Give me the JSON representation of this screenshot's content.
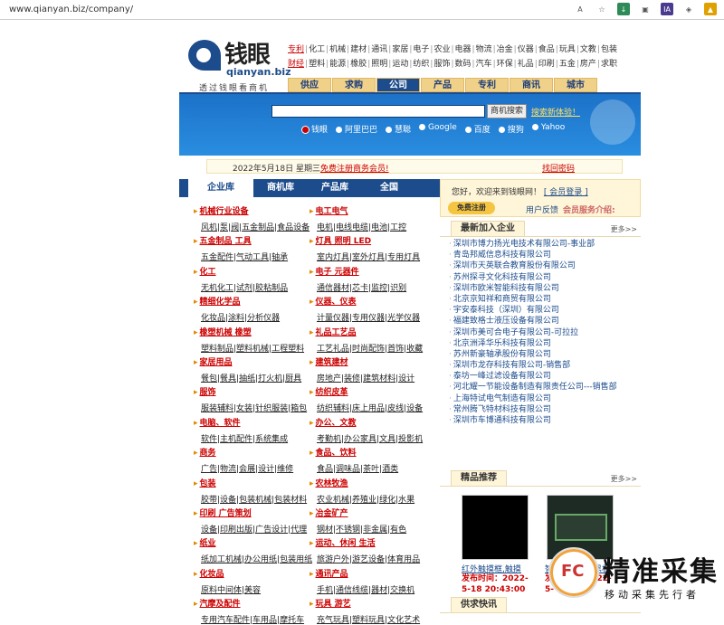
{
  "browser": {
    "url": "www.qianyan.biz/company/",
    "icons": [
      "read-aloud-icon",
      "favorites-icon",
      "extension-green-icon",
      "extension-dark-icon",
      "ia-icon",
      "extension-yellow-icon"
    ]
  },
  "logo": {
    "cn": "钱眼",
    "en": "qianyan.biz",
    "slogan": "透过钱眼看商机"
  },
  "toplinks": {
    "row1": [
      "专利",
      "化工",
      "机械",
      "建材",
      "通讯",
      "家居",
      "电子",
      "农业",
      "电器",
      "物流",
      "冶金",
      "仪器",
      "食品",
      "玩具",
      "文教",
      "包装"
    ],
    "row2": [
      "财经",
      "塑料",
      "能源",
      "橡胶",
      "照明",
      "运动",
      "纺织",
      "服饰",
      "数码",
      "汽车",
      "环保",
      "礼品",
      "印刷",
      "五金",
      "房产",
      "求职"
    ]
  },
  "mainnav": [
    "供应",
    "求购",
    "公司",
    "产品",
    "专利",
    "商讯",
    "城市"
  ],
  "search": {
    "button": "商机搜索",
    "new": "搜索新体验！",
    "engines": [
      "钱眼",
      "阿里巴巴",
      "慧聪",
      "Google",
      "百度",
      "搜狗",
      "Yahoo"
    ]
  },
  "datebar": {
    "date": "2022年5月18日 星期三",
    "register": "免费注册商务会员!",
    "forgot": "找回密码"
  },
  "tabs": [
    "企业库",
    "商机库",
    "产品库",
    "全国"
  ],
  "categories": [
    {
      "h": "机械行业设备",
      "s": "风机|泵|阀|五金制品|食品设备"
    },
    {
      "h": "电工电气",
      "s": "电机|电线电缆|电池|工控"
    },
    {
      "h": "五金制品 工具",
      "s": "五金配件|气动工具|轴承"
    },
    {
      "h": "灯具 照明 LED",
      "s": "室内灯具|室外灯具|专用灯具"
    },
    {
      "h": "化工",
      "s": "无机化工|试剂|胶粘制品"
    },
    {
      "h": "电子 元器件",
      "s": "通信器材|芯卡|监控|识别"
    },
    {
      "h": "精细化学品",
      "s": "化妆品|涂料|分析仪器"
    },
    {
      "h": "仪器、仪表",
      "s": "计量仪器|专用仪器|光学仪器"
    },
    {
      "h": "橡塑机械 橡塑",
      "s": "塑料制品|塑料机械|工程塑料"
    },
    {
      "h": "礼品工艺品",
      "s": "工艺礼品|时尚配饰|首饰|收藏"
    },
    {
      "h": "家居用品",
      "s": "餐包|餐具|抽纸|打火机|厨具"
    },
    {
      "h": "建筑建材",
      "s": "房地产|装修|建筑材料|设计"
    },
    {
      "h": "服饰",
      "s": "服装辅料|女装|针织服装|箱包"
    },
    {
      "h": "纺织皮革",
      "s": "纺织辅料|床上用品|皮线|设备"
    },
    {
      "h": "电脑、软件",
      "s": "软件|主机配件|系统集成"
    },
    {
      "h": "办公、文教",
      "s": "考勤机|办公家具|文具|投影机"
    },
    {
      "h": "商务",
      "s": "广告|物流|会展|设计|维修"
    },
    {
      "h": "食品、饮料",
      "s": "食品|调味品|茶叶|酒类"
    },
    {
      "h": "包装",
      "s": "胶带|设备|包装机械|包装材料"
    },
    {
      "h": "农林牧渔",
      "s": "农业机械|养殖业|绿化|水果"
    },
    {
      "h": "印刷 广告策划",
      "s": "设备|印刷出版|广告设计|代理"
    },
    {
      "h": "冶金矿产",
      "s": "钢材|不锈钢|非金属|有色"
    },
    {
      "h": "纸业",
      "s": "纸加工机械|办公用纸|包装用纸"
    },
    {
      "h": "运动、休闲 生活",
      "s": "旅游户外|游艺设备|体育用品"
    },
    {
      "h": "化妆品",
      "s": "原料中间体|美容"
    },
    {
      "h": "通讯产品",
      "s": "手机|通信线缆|器材|交换机"
    },
    {
      "h": "汽摩及配件",
      "s": "专用汽车配件|车用品|摩托车"
    },
    {
      "h": "玩具 游艺",
      "s": "充气玩具|塑料玩具|文化艺术"
    }
  ],
  "welcome": {
    "text": "您好，欢迎来到钱眼网！",
    "login": "[ 会员登录 ]",
    "register_btn": "免费注册",
    "feedback": "用户反馈",
    "vip": "会员服务介绍:"
  },
  "newest": {
    "title": "最新加入企业",
    "more": "更多>>",
    "items": [
      "深圳市博力扬光电技术有限公司-事业部",
      "青岛邦威信息科技有限公司",
      "深圳市天英联合教育股份有限公司",
      "苏州探寻文化科技有限公司",
      "深圳市欧米智能科技有限公司",
      "北京京知祥和商贸有限公司",
      "宇安泰科技（深圳）有限公司",
      "福建致格士液压设备有限公司",
      "深圳市美可合电子有限公司-可拉拉",
      "北京洲泽华乐科技有限公司",
      "苏州新豪轴承股份有限公司",
      "深圳市龙存科技有限公司-销售部",
      "泰坊一峰过滤设备有限公司",
      "河北耀一节能设备制造有限责任公司---销售部",
      "上海特试电气制造有限公司",
      "常州腾飞特材科技有限公司",
      "深圳市车博通科技有限公司"
    ]
  },
  "featured": {
    "title": "精品推荐",
    "more": "更多>>",
    "items": [
      {
        "caption": "红外触摸框,触摸",
        "date": "发布时间：2022-5-18 20:43:00"
      },
      {
        "caption": "智慧黑板纳米黑板",
        "date": "发布时间：2022-5-"
      }
    ]
  },
  "express": {
    "title": "供求快讯"
  },
  "watermark": {
    "fc": "FC",
    "big": "精准采集",
    "small": "移动采集先行者"
  }
}
